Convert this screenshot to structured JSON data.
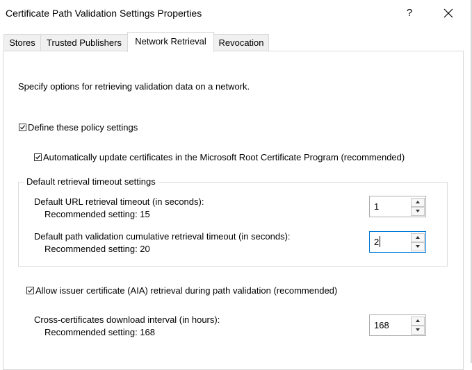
{
  "window": {
    "title": "Certificate Path Validation Settings Properties",
    "help_label": "?",
    "close_icon": "close-icon"
  },
  "tabs": [
    {
      "label": "Stores",
      "active": false
    },
    {
      "label": "Trusted Publishers",
      "active": false
    },
    {
      "label": "Network Retrieval",
      "active": true
    },
    {
      "label": "Revocation",
      "active": false
    }
  ],
  "panel": {
    "intro": "Specify options for retrieving validation data on a network.",
    "define_policy": {
      "label": "Define these policy settings",
      "checked": true
    },
    "auto_update": {
      "label": "Automatically update certificates in the Microsoft Root Certificate Program (recommended)",
      "checked": true
    },
    "timeout_group": {
      "legend": "Default retrieval timeout settings",
      "url_timeout": {
        "label": "Default URL retrieval timeout (in seconds):",
        "recommended": "Recommended setting: 15",
        "value": "1"
      },
      "path_timeout": {
        "label": "Default path validation cumulative retrieval timeout (in seconds):",
        "recommended": "Recommended setting: 20",
        "value": "2"
      }
    },
    "aia_retrieval": {
      "label": "Allow issuer certificate (AIA) retrieval during path validation (recommended)",
      "checked": true
    },
    "cross_cert": {
      "label": "Cross-certificates download interval (in hours):",
      "recommended": "Recommended setting: 168",
      "value": "168"
    }
  }
}
